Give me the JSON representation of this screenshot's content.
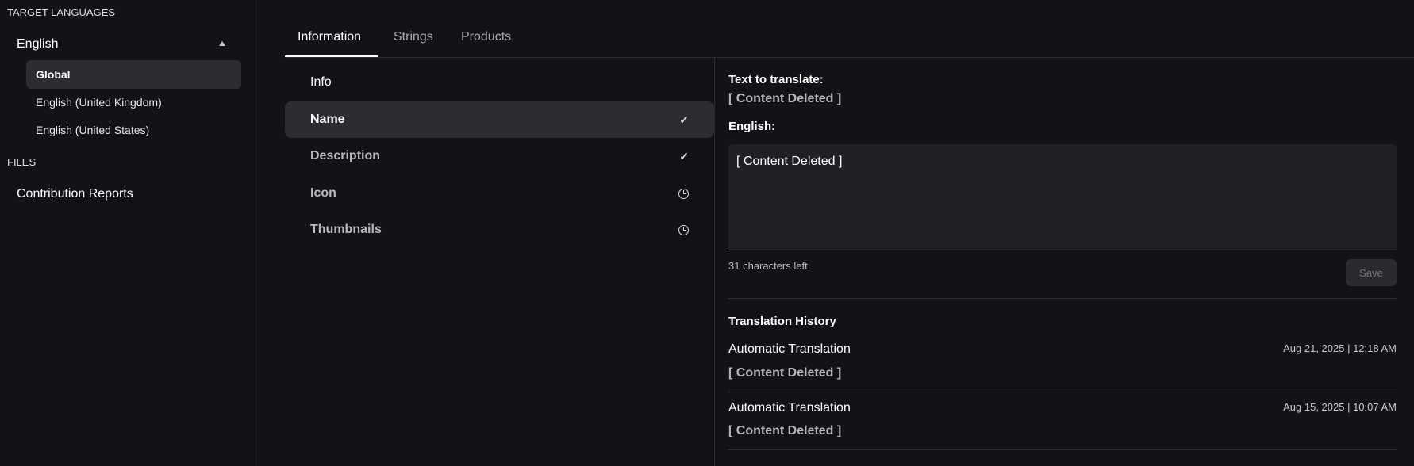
{
  "sidebar": {
    "target_languages_label": "TARGET LANGUAGES",
    "language": "English",
    "locales": [
      "Global",
      "English (United Kingdom)",
      "English (United States)"
    ],
    "files_label": "FILES",
    "contribution_reports": "Contribution Reports"
  },
  "tabs": [
    "Information",
    "Strings",
    "Products"
  ],
  "fields": [
    {
      "label": "Info",
      "status": ""
    },
    {
      "label": "Name",
      "status": "done"
    },
    {
      "label": "Description",
      "status": "done"
    },
    {
      "label": "Icon",
      "status": "pending"
    },
    {
      "label": "Thumbnails",
      "status": "pending"
    }
  ],
  "detail": {
    "text_to_translate_label": "Text to translate:",
    "source_text": "[ Content Deleted ]",
    "target_label": "English:",
    "translation_value": "[ Content Deleted ]",
    "chars_left": "31 characters left",
    "save_label": "Save",
    "history_title": "Translation History",
    "history": [
      {
        "title": "Automatic Translation",
        "date": "Aug 21, 2025 | 12:18 AM",
        "text": "[ Content Deleted ]"
      },
      {
        "title": "Automatic Translation",
        "date": "Aug 15, 2025 | 10:07 AM",
        "text": "[ Content Deleted ]"
      }
    ]
  }
}
